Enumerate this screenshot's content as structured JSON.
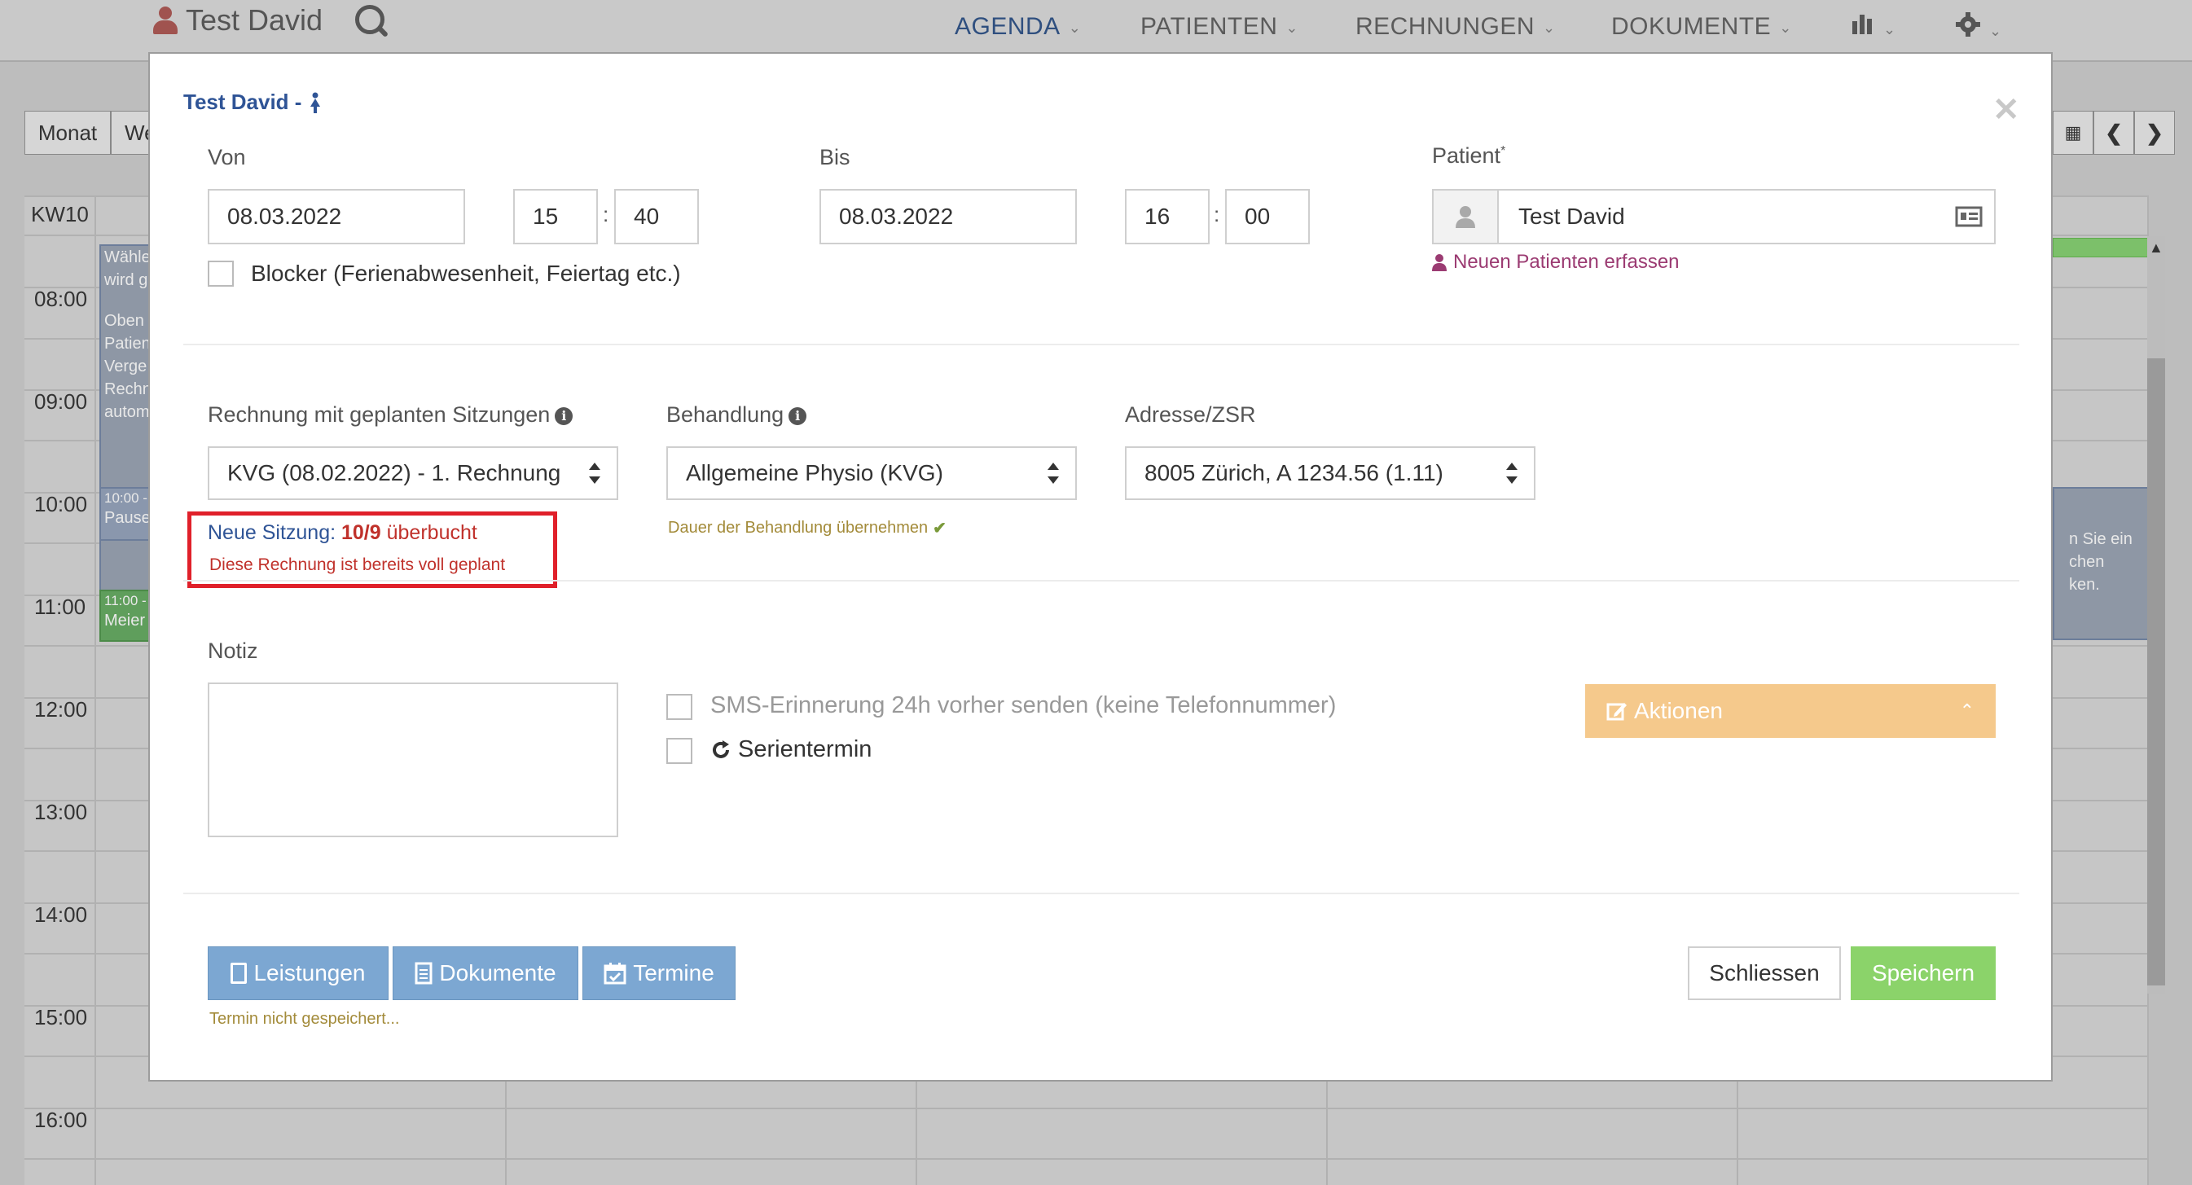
{
  "app": {
    "user_name": "Test David",
    "nav": [
      {
        "label": "AGENDA"
      },
      {
        "label": "PATIENTEN"
      },
      {
        "label": "RECHNUNGEN"
      },
      {
        "label": "DOKUMENTE"
      }
    ],
    "view_buttons": {
      "month": "Monat",
      "week": "We"
    },
    "week_label": "KW10",
    "times": [
      "08:00",
      "09:00",
      "10:00",
      "11:00",
      "12:00",
      "13:00",
      "14:00",
      "15:00",
      "16:00"
    ],
    "events": {
      "e1_a": "Wähle",
      "e1_b": "wird g",
      "e2_a": "Oben",
      "e2_b": "Patien",
      "e2_c": "Verge",
      "e2_d": "Rechn",
      "e2_e": "autom",
      "e3_a": "10:00 -",
      "e3_b": "Pause",
      "e4_a": "11:00 -",
      "e4_b": "Meier",
      "e5_a": "n Sie ein",
      "e5_b": "chen",
      "e5_c": "ken.",
      "e6_a": "-"
    }
  },
  "modal": {
    "title": "Test David -",
    "von_label": "Von",
    "von_date": "08.03.2022",
    "von_hour": "15",
    "von_min": "40",
    "bis_label": "Bis",
    "bis_date": "08.03.2022",
    "bis_hour": "16",
    "bis_min": "00",
    "time_sep": ":",
    "patient_label": "Patient",
    "patient_required": "*",
    "patient_name": "Test David",
    "new_patient_link": "Neuen Patienten erfassen",
    "blocker_label": "Blocker (Ferienabwesenheit, Feiertag etc.)",
    "invoice_label": "Rechnung mit geplanten Sitzungen",
    "invoice_value": "KVG (08.02.2022) - 1. Rechnung",
    "treatment_label": "Behandlung",
    "treatment_value": "Allgemeine Physio (KVG)",
    "address_label": "Adresse/ZSR",
    "address_value": "8005 Zürich, A 1234.56 (1.11)",
    "session_prefix": "Neue Sitzung:",
    "session_count": "10/9",
    "session_status": "überbucht",
    "session_warning": "Diese Rechnung ist bereits voll geplant",
    "duration_hint": "Dauer der Behandlung übernehmen",
    "note_label": "Notiz",
    "note_value": "",
    "sms_label": "SMS-Erinnerung 24h vorher senden (keine Telefonnummer)",
    "series_label": "Serientermin",
    "actions_label": "Aktionen",
    "btn_services": "Leistungen",
    "btn_documents": "Dokumente",
    "btn_appointments": "Termine",
    "unsaved_hint": "Termin nicht gespeichert...",
    "btn_close": "Schliessen",
    "btn_save": "Speichern",
    "colors": {
      "accent_blue": "#2f5496",
      "danger_red": "#c0312b",
      "warning_gold": "#a38b3a",
      "actions_orange": "#f5c98c",
      "save_green": "#8bd36a",
      "tab_blue": "#7ca7d2",
      "link_purple": "#9b3b72"
    },
    "icons": [
      "female-icon",
      "user-silhouette-icon",
      "contact-card-icon",
      "user-icon",
      "info-icon",
      "checkmark-icon",
      "refresh-icon",
      "edit-icon",
      "chevron-up-icon",
      "file-icon",
      "document-icon",
      "calendar-check-icon",
      "close-icon"
    ]
  }
}
